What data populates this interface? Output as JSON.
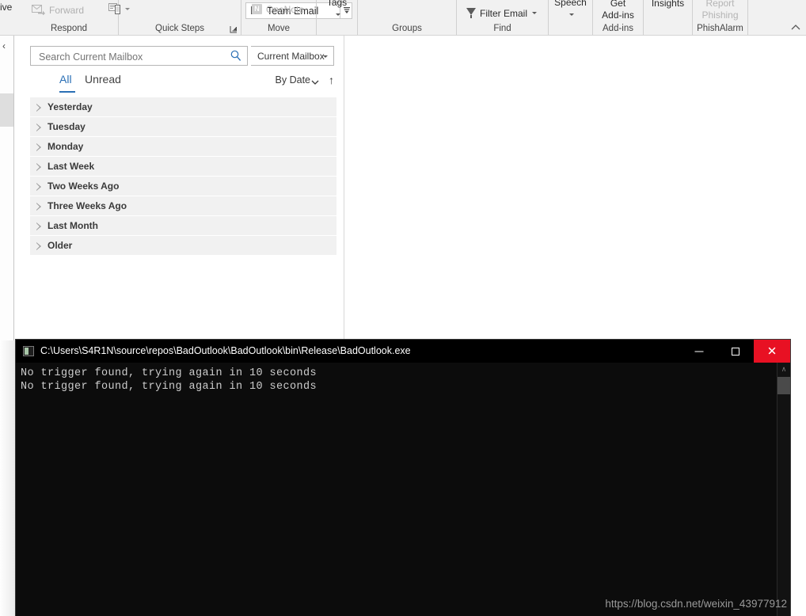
{
  "ribbon": {
    "archive_cut_label": "ive",
    "groups": [
      {
        "name": "respond",
        "label": "Respond"
      },
      {
        "name": "quick-steps",
        "label": "Quick Steps"
      },
      {
        "name": "move",
        "label": "Move"
      },
      {
        "name": "groups",
        "label": "Groups"
      },
      {
        "name": "find",
        "label": "Find"
      },
      {
        "name": "add-ins",
        "label": "Add-ins"
      },
      {
        "name": "phishalarm",
        "label": "PhishAlarm"
      }
    ],
    "buttons": {
      "forward": "Forward",
      "team_email": "Team Email",
      "onenote": "OneNote",
      "onenote_badge": "N",
      "tags": "Tags",
      "filter_email": "Filter Email",
      "speech": "Speech",
      "get_addins_line1": "Get",
      "get_addins_line2": "Add-ins",
      "insights": "Insights",
      "report_phishing_line1": "Report",
      "report_phishing_line2": "Phishing"
    }
  },
  "nav": {
    "expand_icon": "chevron-left",
    "expand_glyph": "‹"
  },
  "mail_pane": {
    "search": {
      "placeholder": "Search Current Mailbox",
      "value": "",
      "scope": "Current Mailbox"
    },
    "filters": {
      "all": "All",
      "unread": "Unread",
      "active": "All"
    },
    "sort": {
      "label": "By Date",
      "direction_glyph": "↑"
    },
    "groups": [
      {
        "label": "Yesterday"
      },
      {
        "label": "Tuesday"
      },
      {
        "label": "Monday"
      },
      {
        "label": "Last Week"
      },
      {
        "label": "Two Weeks Ago"
      },
      {
        "label": "Three Weeks Ago"
      },
      {
        "label": "Last Month"
      },
      {
        "label": "Older"
      }
    ]
  },
  "console": {
    "title": "C:\\Users\\S4R1N\\source\\repos\\BadOutlook\\BadOutlook\\bin\\Release\\BadOutlook.exe",
    "output": "No trigger found, trying again in 10 seconds\nNo trigger found, trying again in 10 seconds",
    "window_buttons": {
      "minimize": "–",
      "maximize": "□",
      "close": "✕"
    },
    "scroll_up_glyph": "∧"
  },
  "watermark": {
    "text": "https://blog.csdn.net/weixin_43977912"
  },
  "colors": {
    "accent_blue": "#2a6fb5",
    "close_red": "#e81123",
    "console_bg": "#0c0c0c",
    "ribbon_bg": "#f1f1f1",
    "group_row_bg": "#f1f1f1"
  }
}
